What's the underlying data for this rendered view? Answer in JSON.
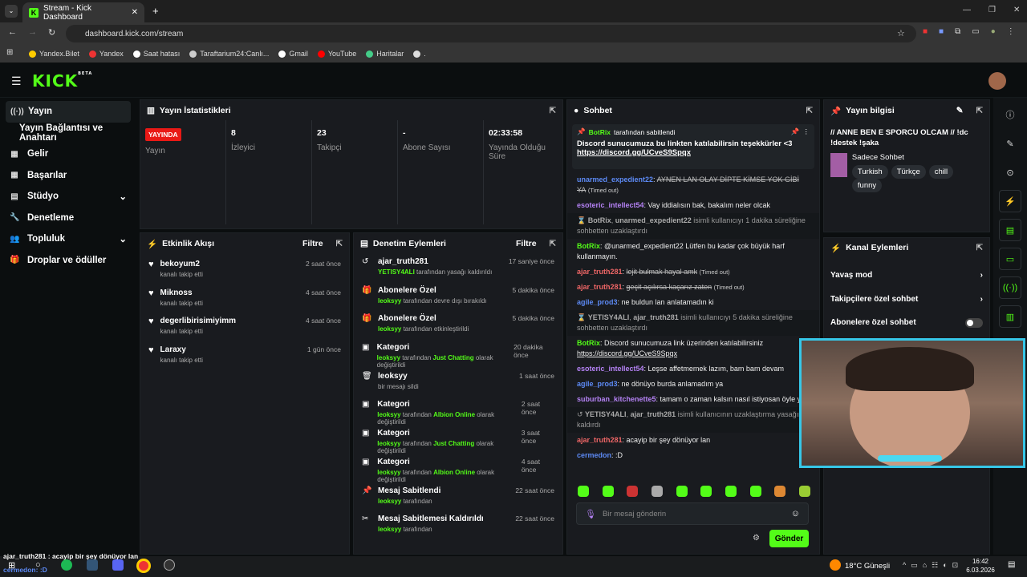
{
  "browser": {
    "tab_title": "Stream - Kick Dashboard",
    "url": "dashboard.kick.com/stream",
    "bookmarks": [
      "Yandex.Bilet",
      "Yandex",
      "Saat hatası",
      "Taraftarium24:Canlı...",
      "Gmail",
      "YouTube",
      "Haritalar",
      "."
    ]
  },
  "app": {
    "logo": "KICK",
    "beta": "BETA"
  },
  "sidebar": {
    "items": [
      {
        "label": "Yayın",
        "icon": "((·))"
      },
      {
        "label": "Yayın Bağlantısı ve Anahtarı",
        "icon": ""
      },
      {
        "label": "Gelir",
        "icon": "▦"
      },
      {
        "label": "Başarılar",
        "icon": "▦"
      },
      {
        "label": "Stüdyo",
        "icon": "▤"
      },
      {
        "label": "Denetleme",
        "icon": "🔧"
      },
      {
        "label": "Topluluk",
        "icon": "👥"
      },
      {
        "label": "Droplar ve ödüller",
        "icon": "🎁"
      }
    ]
  },
  "stats": {
    "title": "Yayın İstatistikleri",
    "live_badge": "YAYINDA",
    "live_label": "Yayın",
    "viewers": {
      "value": "8",
      "label": "İzleyici"
    },
    "followers": {
      "value": "23",
      "label": "Takipçi"
    },
    "subs": {
      "value": "-",
      "label": "Abone Sayısı"
    },
    "uptime": {
      "value": "02:33:58",
      "label": "Yayında Olduğu Süre"
    }
  },
  "activity": {
    "title": "Etkinlik Akışı",
    "filter": "Filtre",
    "items": [
      {
        "name": "bekoyum2",
        "sub": "kanalı takip etti",
        "time": "2 saat önce"
      },
      {
        "name": "Miknoss",
        "sub": "kanalı takip etti",
        "time": "4 saat önce"
      },
      {
        "name": "degerlibirisimiyimm",
        "sub": "kanalı takip etti",
        "time": "4 saat önce"
      },
      {
        "name": "Laraxy",
        "sub": "kanalı takip etti",
        "time": "1 gün önce"
      }
    ]
  },
  "moderation": {
    "title": "Denetim Eylemleri",
    "filter": "Filtre",
    "items": [
      {
        "title": "ajar_truth281",
        "user": "YETISY4ALI",
        "rest": " tarafından yasağı kaldırıldı",
        "hl": "",
        "tail": "",
        "time": "17 saniye önce"
      },
      {
        "title": "Abonelere Özel",
        "user": "leoksyy",
        "rest": " tarafından devre dışı bırakıldı",
        "hl": "",
        "tail": "",
        "time": "5 dakika önce"
      },
      {
        "title": "Abonelere Özel",
        "user": "leoksyy",
        "rest": " tarafından etkinleştirildi",
        "hl": "",
        "tail": "",
        "time": "5 dakika önce"
      },
      {
        "title": "Kategori",
        "user": "leoksyy",
        "rest": " tarafından ",
        "hl": "Just Chatting",
        "tail": " olarak değiştirildi",
        "time": "20 dakika önce"
      },
      {
        "title": "leoksyy",
        "user": "",
        "rest": "bir mesajı sildi",
        "hl": "",
        "tail": "",
        "time": "1 saat önce"
      },
      {
        "title": "Kategori",
        "user": "leoksyy",
        "rest": " tarafından ",
        "hl": "Albion Online",
        "tail": " olarak değiştirildi",
        "time": "2 saat önce"
      },
      {
        "title": "Kategori",
        "user": "leoksyy",
        "rest": " tarafından ",
        "hl": "Just Chatting",
        "tail": " olarak değiştirildi",
        "time": "3 saat önce"
      },
      {
        "title": "Kategori",
        "user": "leoksyy",
        "rest": " tarafından ",
        "hl": "Albion Online",
        "tail": " olarak değiştirildi",
        "time": "4 saat önce"
      },
      {
        "title": "Mesaj Sabitlendi",
        "user": "leoksyy",
        "rest": " tarafından",
        "hl": "",
        "tail": "",
        "time": "22 saat önce"
      },
      {
        "title": "Mesaj Sabitlemesi Kaldırıldı",
        "user": "leoksyy",
        "rest": " tarafından",
        "hl": "",
        "tail": "",
        "time": "22 saat önce"
      }
    ]
  },
  "chat": {
    "title": "Sohbet",
    "pinned_by": "BotRix",
    "pinned_by_suffix": "tarafından sabitlendi",
    "pinned_text": "Discord sunucumuza bu linkten katılabilirsin teşekkürler <3",
    "pinned_link": "https://discord.gg/UCveS9Spqx",
    "placeholder": "Bir mesaj gönderin",
    "send": "Gönder"
  },
  "stream_info": {
    "title": "Yayın bilgisi",
    "stream_title": "// ANNE BEN E SPORCU OLCAM // !dc !destek !şaka",
    "category": "Sadece Sohbet",
    "tags": [
      "Turkish",
      "Türkçe",
      "chill",
      "funny"
    ]
  },
  "channel_actions": {
    "title": "Kanal Eylemleri",
    "items": [
      "Yavaş mod",
      "Takipçilere özel sohbet",
      "Abonelere özel sohbet"
    ]
  },
  "taskbar": {
    "overlay": "ajar_truth281 : acayip bir şey dönüyor lan",
    "overlay2": "cermedon: :D",
    "weather": "18°C  Güneşli",
    "time": "16:42",
    "date": "6.03.2026"
  }
}
